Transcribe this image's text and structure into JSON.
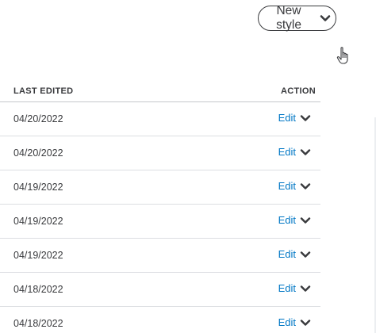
{
  "toolbar": {
    "new_style_label": "New style",
    "new_style_icon": "chevron-down-icon",
    "cursor_icon": "hand-pointer-icon"
  },
  "table": {
    "headers": {
      "last_edited": "LAST EDITED",
      "action": "ACTION"
    },
    "rows": [
      {
        "last_edited": "04/20/2022",
        "action_label": "Edit"
      },
      {
        "last_edited": "04/20/2022",
        "action_label": "Edit"
      },
      {
        "last_edited": "04/19/2022",
        "action_label": "Edit"
      },
      {
        "last_edited": "04/19/2022",
        "action_label": "Edit"
      },
      {
        "last_edited": "04/19/2022",
        "action_label": "Edit"
      },
      {
        "last_edited": "04/18/2022",
        "action_label": "Edit"
      },
      {
        "last_edited": "04/18/2022",
        "action_label": "Edit"
      }
    ]
  },
  "colors": {
    "text": "#393a3d",
    "link": "#0077c5",
    "divider": "#dcdee2"
  }
}
